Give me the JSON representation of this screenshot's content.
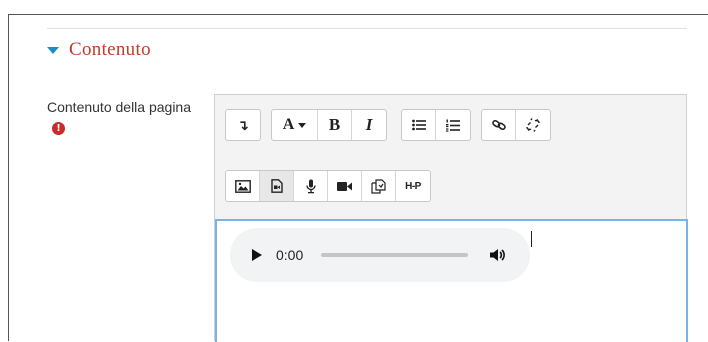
{
  "section": {
    "title": "Contenuto"
  },
  "field": {
    "label": "Contenuto della pagina",
    "required_icon_glyph": "!"
  },
  "toolbar": {
    "row1": [
      {
        "name": "paragraph-style-icon",
        "glyph": "↴"
      },
      {
        "name": "font-style-menu",
        "glyph": "A"
      },
      {
        "name": "bold-button",
        "glyph": "B"
      },
      {
        "name": "italic-button",
        "glyph": "I"
      },
      {
        "name": "unordered-list-icon"
      },
      {
        "name": "ordered-list-icon"
      },
      {
        "name": "link-icon"
      },
      {
        "name": "unlink-icon"
      }
    ],
    "row2": [
      {
        "name": "image-icon"
      },
      {
        "name": "media-icon",
        "active": true
      },
      {
        "name": "microphone-icon"
      },
      {
        "name": "video-camera-icon"
      },
      {
        "name": "manage-files-icon"
      },
      {
        "name": "h5p-icon",
        "glyph": "H-P"
      }
    ]
  },
  "audio_player": {
    "current_time": "0:00",
    "progress": 0
  },
  "colors": {
    "section_title": "#c23a2b",
    "caret": "#1a8ec2",
    "required": "#c92c2c",
    "content_focus_border": "#7bb3e8"
  }
}
